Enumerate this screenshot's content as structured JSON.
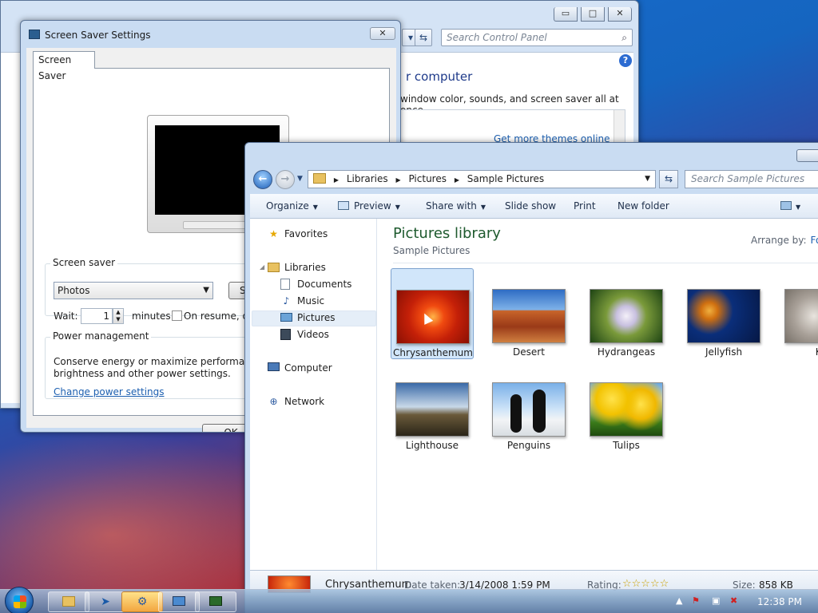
{
  "control_panel": {
    "search_placeholder": "Search Control Panel",
    "heading": "r computer",
    "subtitle": "window color, sounds, and screen saver all at once.",
    "themes_link": "Get more themes online",
    "help": "?"
  },
  "screensaver_dialog": {
    "title": "Screen Saver Settings",
    "tab": "Screen Saver",
    "group_label": "Screen saver",
    "selected_saver": "Photos",
    "settings_button": "Set",
    "wait_label": "Wait:",
    "wait_value": "1",
    "minutes_label": "minutes",
    "resume_label": "On resume, dis",
    "power_label": "Power management",
    "power_text_1": "Conserve energy or maximize performance by",
    "power_text_2": "brightness and other power settings.",
    "power_link": "Change power settings",
    "ok_button": "OK"
  },
  "explorer": {
    "breadcrumb": [
      "Libraries",
      "Pictures",
      "Sample Pictures"
    ],
    "search_placeholder": "Search Sample Pictures",
    "toolbar": {
      "organize": "Organize",
      "preview": "Preview",
      "share_with": "Share with",
      "slide_show": "Slide show",
      "print": "Print",
      "new_folder": "New folder"
    },
    "nav": {
      "favorites": "Favorites",
      "libraries": "Libraries",
      "documents": "Documents",
      "music": "Music",
      "pictures": "Pictures",
      "videos": "Videos",
      "computer": "Computer",
      "network": "Network"
    },
    "library_title": "Pictures library",
    "library_subtitle": "Sample Pictures",
    "arrange_label": "Arrange by:",
    "arrange_value": "Fo",
    "items": [
      "Chrysanthemum",
      "Desert",
      "Hydrangeas",
      "Jellyfish",
      "Ko",
      "Lighthouse",
      "Penguins",
      "Tulips"
    ],
    "details": {
      "name": "Chrysanthemum",
      "date_label": "Date taken:",
      "date_value": "3/14/2008 1:59 PM",
      "rating_label": "Rating:",
      "rating_stars": "☆☆☆☆☆",
      "size_label": "Size:",
      "size_value": "858 KB"
    }
  },
  "taskbar": {
    "clock": "12:38 PM"
  }
}
